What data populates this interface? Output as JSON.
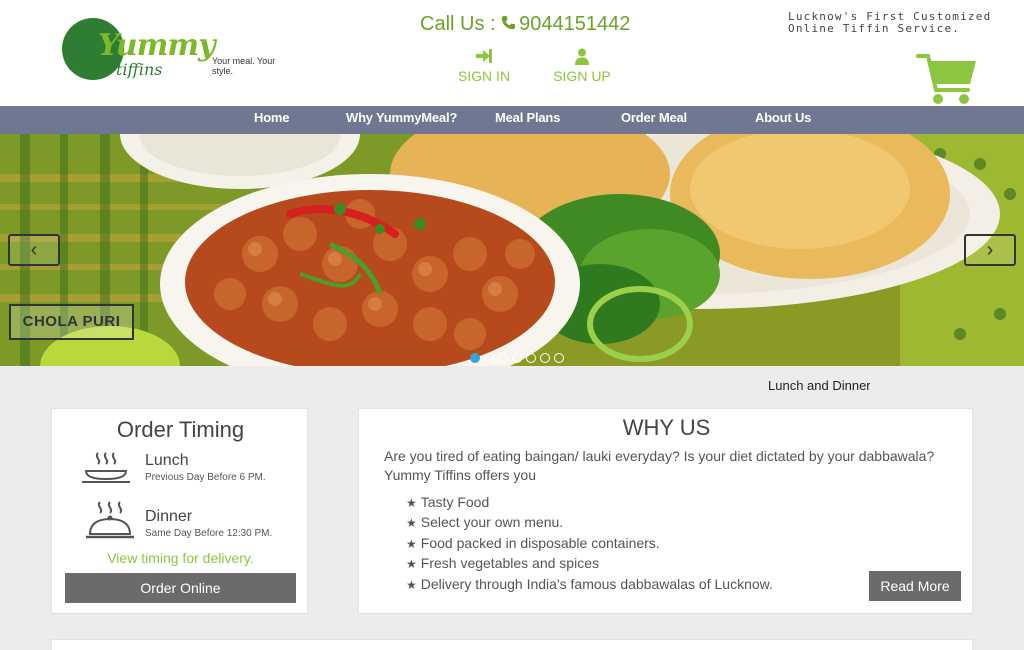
{
  "brand": {
    "logo_word": "Yummy",
    "logo_sub": "tiffins",
    "logo_tag": "Your meal. Your style."
  },
  "header": {
    "call_label": "Call Us :",
    "phone": "9044151442",
    "sign_in": "SIGN IN",
    "sign_up": "SIGN UP",
    "tagline": "Lucknow's First Customized Online Tiffin Service."
  },
  "nav": {
    "items": [
      "Home",
      "Why YummyMeal?",
      "Meal Plans",
      "Order Meal",
      "About Us"
    ]
  },
  "slider": {
    "caption": "CHOLA PURI",
    "prev_glyph": "‹",
    "next_glyph": "›",
    "slide_count": 7,
    "active_slide": 0
  },
  "ticker": "Lunch and Dinner",
  "order_timing": {
    "title": "Order Timing",
    "meals": [
      {
        "name": "Lunch",
        "time": "Previous Day Before 6 PM.",
        "icon": "hot-dish-icon"
      },
      {
        "name": "Dinner",
        "time": "Same Day Before 12:30 PM.",
        "icon": "cloche-icon"
      }
    ],
    "view_timing": "View timing for delivery.",
    "order_button": "Order Online"
  },
  "why_us": {
    "title": "WHY US",
    "intro": "Are you tired of eating baingan/ lauki everyday? Is your diet dictated by your dabbawala? Yummy Tiffins offers you",
    "points": [
      "Tasty Food",
      "Select your own menu.",
      "Food packed in disposable containers.",
      "Fresh vegetables and spices",
      "Delivery through India's famous dabbawalas of Lucknow."
    ],
    "read_more": "Read More"
  },
  "colors": {
    "brand_green": "#8cc63f",
    "dark_green": "#2e7d32",
    "nav_bg": "#6f7791",
    "button_gray": "#6b6b6b",
    "page_bg": "#ececec"
  }
}
